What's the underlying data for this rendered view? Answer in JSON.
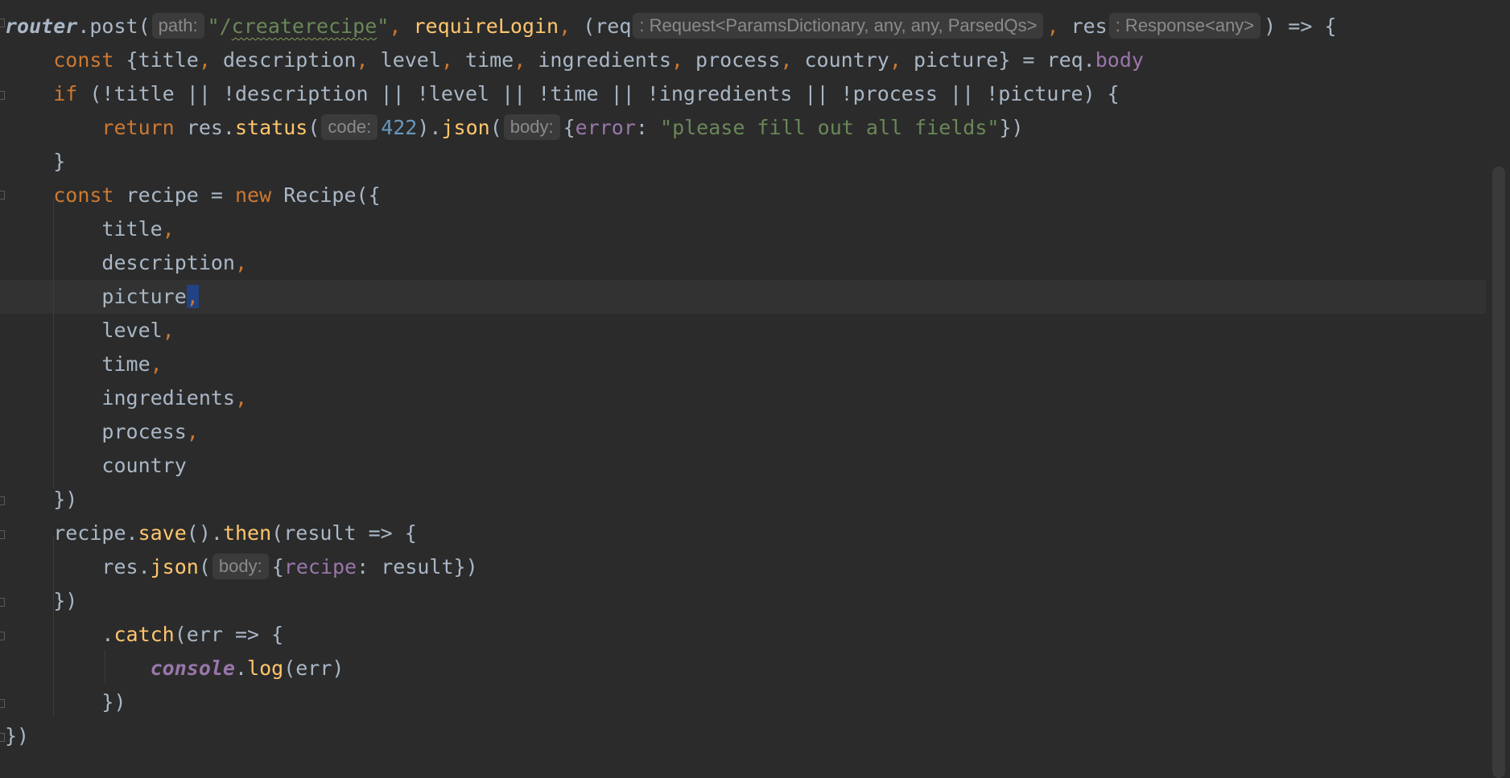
{
  "editor": {
    "lines": [
      [
        {
          "t": "router",
          "c": "router"
        },
        {
          "t": ".post(",
          "c": "plain"
        },
        {
          "t": "path:",
          "c": "hint"
        },
        {
          "t": "\"/",
          "c": "str"
        },
        {
          "t": "createrecipe",
          "c": "strsq"
        },
        {
          "t": "\"",
          "c": "str"
        },
        {
          "t": ", ",
          "c": "kw"
        },
        {
          "t": "requireLogin",
          "c": "fn"
        },
        {
          "t": ", ",
          "c": "kw"
        },
        {
          "t": "(req",
          "c": "plain"
        },
        {
          "t": ": Request<ParamsDictionary, any, any, ParsedQs>",
          "c": "hint"
        },
        {
          "t": ", ",
          "c": "kw"
        },
        {
          "t": "res",
          "c": "plain"
        },
        {
          "t": ": Response<any>",
          "c": "hint"
        },
        {
          "t": ") => {",
          "c": "plain"
        }
      ],
      [
        {
          "t": "    ",
          "c": "plain"
        },
        {
          "t": "const ",
          "c": "kw"
        },
        {
          "t": "{title",
          "c": "plain"
        },
        {
          "t": ", ",
          "c": "kw"
        },
        {
          "t": "description",
          "c": "plain"
        },
        {
          "t": ", ",
          "c": "kw"
        },
        {
          "t": "level",
          "c": "plain"
        },
        {
          "t": ", ",
          "c": "kw"
        },
        {
          "t": "time",
          "c": "plain"
        },
        {
          "t": ", ",
          "c": "kw"
        },
        {
          "t": "ingredients",
          "c": "plain"
        },
        {
          "t": ", ",
          "c": "kw"
        },
        {
          "t": "process",
          "c": "plain"
        },
        {
          "t": ", ",
          "c": "kw"
        },
        {
          "t": "country",
          "c": "plain"
        },
        {
          "t": ", ",
          "c": "kw"
        },
        {
          "t": "picture} = req.",
          "c": "plain"
        },
        {
          "t": "body",
          "c": "prop"
        }
      ],
      [
        {
          "t": "    ",
          "c": "plain"
        },
        {
          "t": "if ",
          "c": "kw"
        },
        {
          "t": "(!title || !description || !level || !time || !ingredients || !process || !picture) {",
          "c": "plain"
        }
      ],
      [
        {
          "t": "        ",
          "c": "plain"
        },
        {
          "t": "return ",
          "c": "kw"
        },
        {
          "t": "res.",
          "c": "plain"
        },
        {
          "t": "status",
          "c": "fn"
        },
        {
          "t": "(",
          "c": "plain"
        },
        {
          "t": "code:",
          "c": "hint"
        },
        {
          "t": "422",
          "c": "num"
        },
        {
          "t": ").",
          "c": "plain"
        },
        {
          "t": "json",
          "c": "fn"
        },
        {
          "t": "(",
          "c": "plain"
        },
        {
          "t": "body:",
          "c": "hint"
        },
        {
          "t": "{",
          "c": "plain"
        },
        {
          "t": "error",
          "c": "prop"
        },
        {
          "t": ": ",
          "c": "plain"
        },
        {
          "t": "\"please fill out all fields\"",
          "c": "str"
        },
        {
          "t": "})",
          "c": "plain"
        }
      ],
      [
        {
          "t": "    }",
          "c": "plain"
        }
      ],
      [
        {
          "t": "    ",
          "c": "plain"
        },
        {
          "t": "const ",
          "c": "kw"
        },
        {
          "t": "recipe = ",
          "c": "plain"
        },
        {
          "t": "new ",
          "c": "kw"
        },
        {
          "t": "Recipe({",
          "c": "plain"
        }
      ],
      [
        {
          "t": "        title",
          "c": "plain"
        },
        {
          "t": ",",
          "c": "kw"
        }
      ],
      [
        {
          "t": "        description",
          "c": "plain"
        },
        {
          "t": ",",
          "c": "kw"
        }
      ],
      [
        {
          "t": "        picture",
          "c": "plain"
        },
        {
          "t": ",",
          "c": "kwsel"
        }
      ],
      [
        {
          "t": "        level",
          "c": "plain"
        },
        {
          "t": ",",
          "c": "kw"
        }
      ],
      [
        {
          "t": "        time",
          "c": "plain"
        },
        {
          "t": ",",
          "c": "kw"
        }
      ],
      [
        {
          "t": "        ingredients",
          "c": "plain"
        },
        {
          "t": ",",
          "c": "kw"
        }
      ],
      [
        {
          "t": "        process",
          "c": "plain"
        },
        {
          "t": ",",
          "c": "kw"
        }
      ],
      [
        {
          "t": "        country",
          "c": "plain"
        }
      ],
      [
        {
          "t": "    })",
          "c": "plain"
        }
      ],
      [
        {
          "t": "    recipe.",
          "c": "plain"
        },
        {
          "t": "save",
          "c": "fn"
        },
        {
          "t": "().",
          "c": "plain"
        },
        {
          "t": "then",
          "c": "fn"
        },
        {
          "t": "(result => {",
          "c": "plain"
        }
      ],
      [
        {
          "t": "        res.",
          "c": "plain"
        },
        {
          "t": "json",
          "c": "fn"
        },
        {
          "t": "(",
          "c": "plain"
        },
        {
          "t": "body:",
          "c": "hint"
        },
        {
          "t": "{",
          "c": "plain"
        },
        {
          "t": "recipe",
          "c": "prop"
        },
        {
          "t": ": result})",
          "c": "plain"
        }
      ],
      [
        {
          "t": "    })",
          "c": "plain"
        }
      ],
      [
        {
          "t": "        .",
          "c": "plain"
        },
        {
          "t": "catch",
          "c": "fn"
        },
        {
          "t": "(err => {",
          "c": "plain"
        }
      ],
      [
        {
          "t": "            ",
          "c": "plain"
        },
        {
          "t": "console",
          "c": "global"
        },
        {
          "t": ".",
          "c": "plain"
        },
        {
          "t": "log",
          "c": "fn"
        },
        {
          "t": "(err)",
          "c": "plain"
        }
      ],
      [
        {
          "t": "        })",
          "c": "plain"
        }
      ],
      [
        {
          "t": "})",
          "c": "plain"
        }
      ]
    ]
  }
}
